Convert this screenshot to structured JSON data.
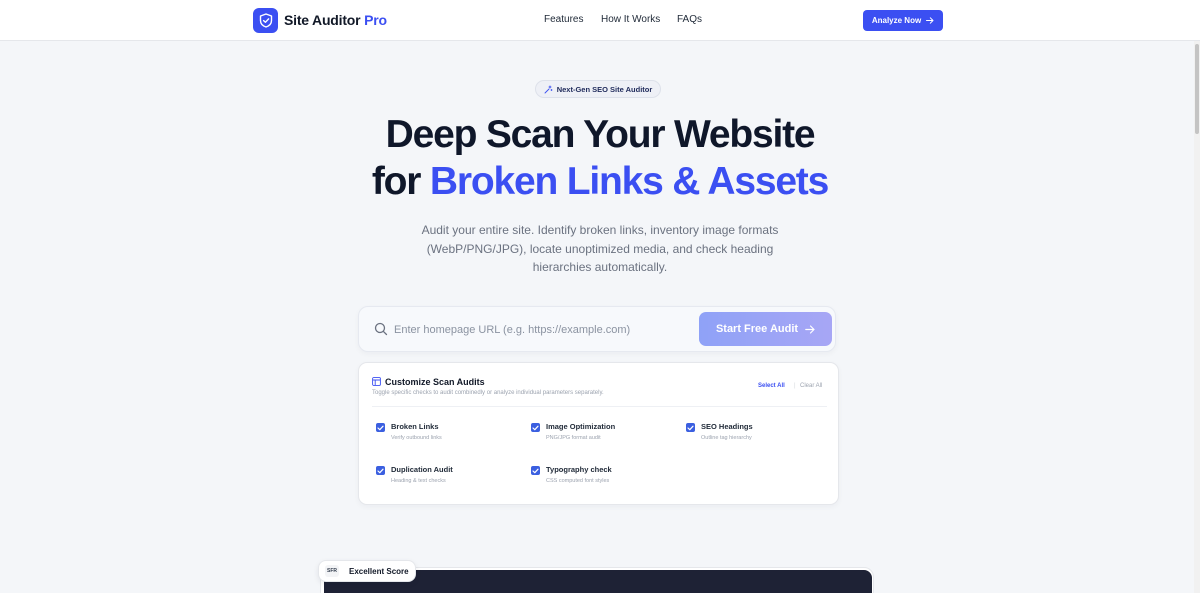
{
  "header": {
    "brand_name": "Site Auditor",
    "brand_accent": "Pro",
    "nav": [
      "Features",
      "How It Works",
      "FAQs"
    ],
    "cta_label": "Analyze Now"
  },
  "hero": {
    "badge": "Next-Gen SEO Site Auditor",
    "title_line1": "Deep Scan Your Website",
    "title_line2_prefix": "for",
    "title_line2_highlight": "Broken Links & Assets",
    "subtitle": "Audit your entire site. Identify broken links, inventory image formats (WebP/PNG/JPG), locate unoptimized media, and check heading hierarchies automatically."
  },
  "search": {
    "placeholder": "Enter homepage URL (e.g. https://example.com)",
    "value": "",
    "button_label": "Start Free Audit"
  },
  "customize": {
    "title": "Customize Scan Audits",
    "description": "Toggle specific checks to audit combinedly or analyze individual parameters separately.",
    "select_all": "Select All",
    "clear_all": "Clear All",
    "options": [
      {
        "label": "Broken Links",
        "sub": "Verify outbound links",
        "checked": true
      },
      {
        "label": "Image Optimization",
        "sub": "PNG/JPG format audit",
        "checked": true
      },
      {
        "label": "SEO Headings",
        "sub": "Outline tag hierarchy",
        "checked": true
      },
      {
        "label": "Duplication Audit",
        "sub": "Heading & text checks",
        "checked": true
      },
      {
        "label": "Typography check",
        "sub": "CSS computed font styles",
        "checked": true
      }
    ]
  },
  "preview": {
    "score_label": "Excellent Score",
    "score_icon_text": "SFR"
  },
  "colors": {
    "accent": "#3b4ff2",
    "button_gradient_start": "#8fa2f7",
    "button_gradient_end": "#a7a6f5",
    "preview_dark": "#1e2235"
  }
}
